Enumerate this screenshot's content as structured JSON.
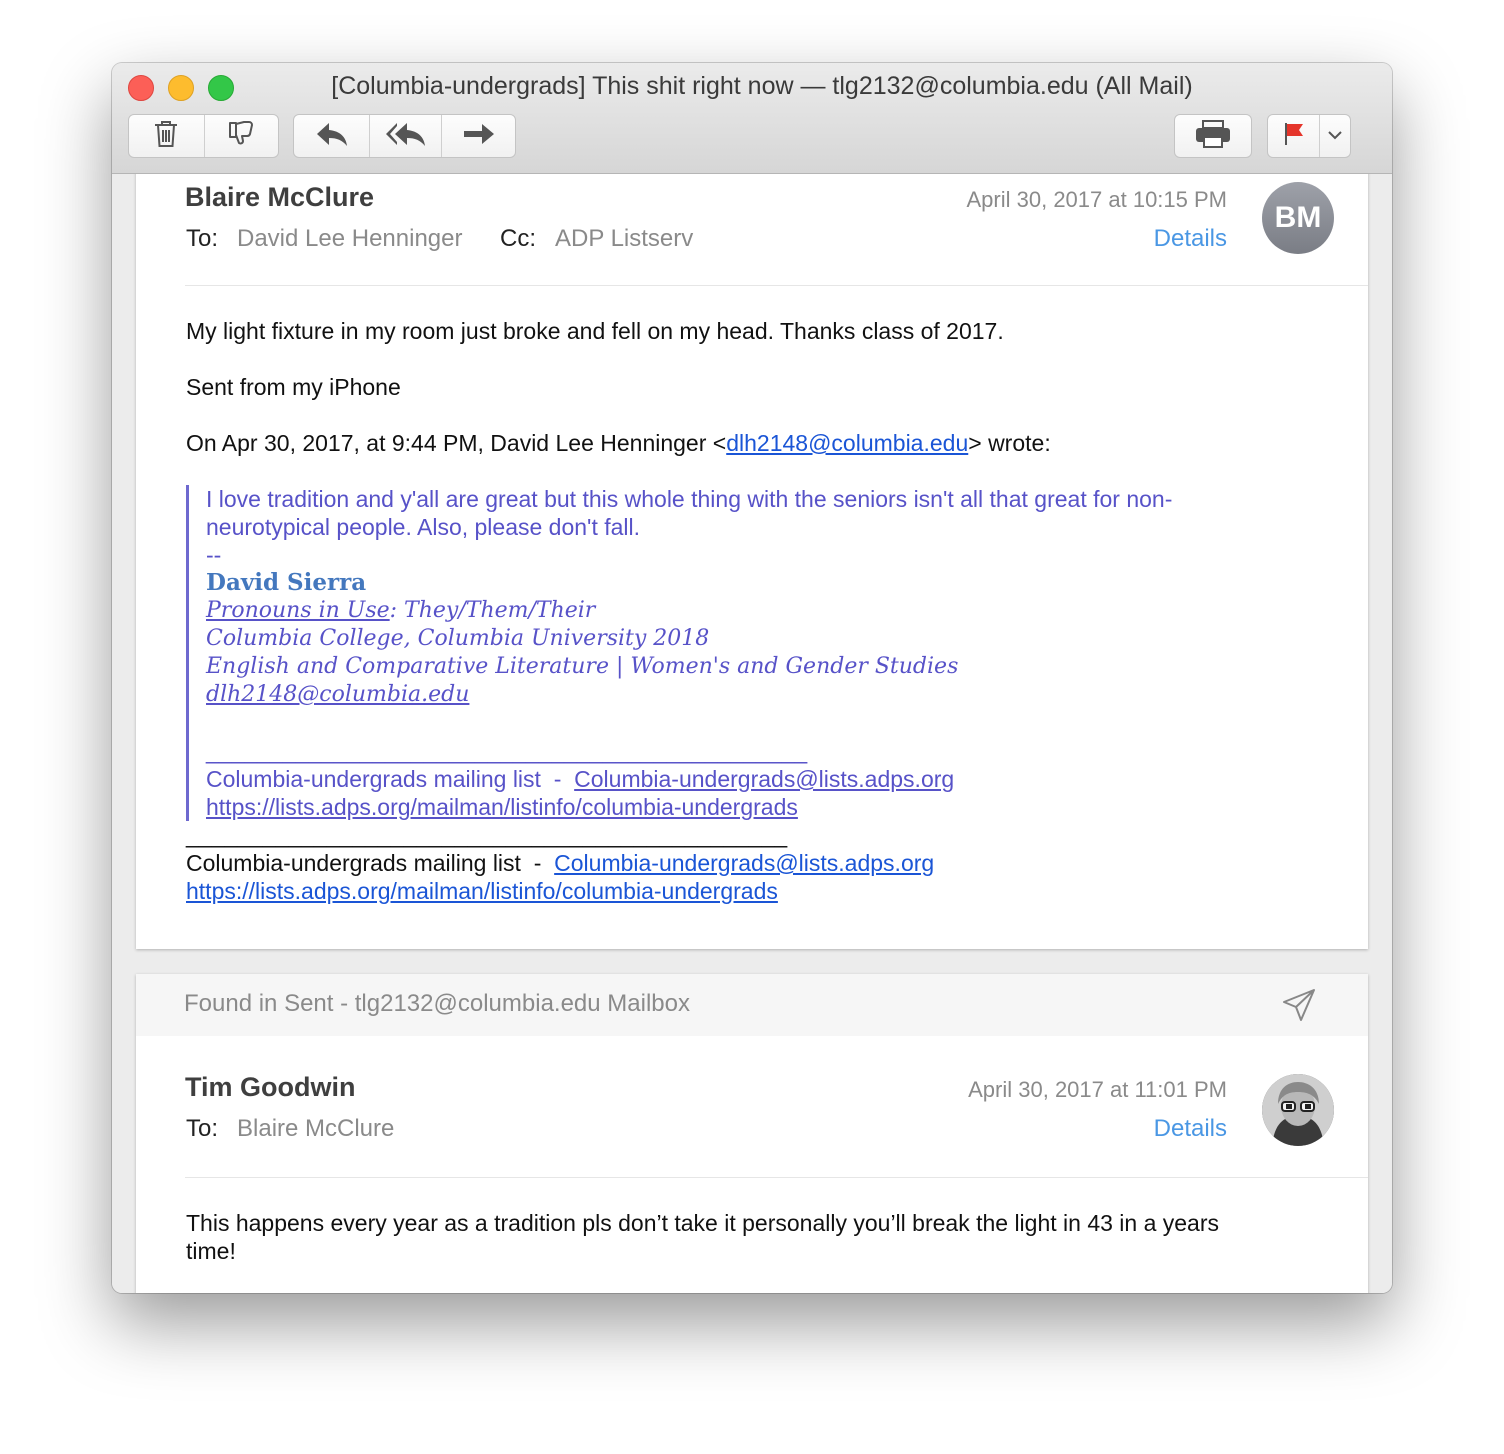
{
  "window": {
    "title": "[Columbia-undergrads] This shit right now — tlg2132@columbia.edu (All Mail)"
  },
  "toolbar": {
    "icons": [
      "trash-icon",
      "thumbs-down-icon",
      "reply-icon",
      "reply-all-icon",
      "forward-icon",
      "printer-icon",
      "flag-icon",
      "chevron-down-icon"
    ],
    "flag_color": "#e5352b"
  },
  "message1": {
    "sender": "Blaire McClure",
    "to_label": "To:",
    "to": "David Lee Henninger",
    "cc_label": "Cc:",
    "cc": "ADP Listserv",
    "date": "April 30, 2017 at 10:15 PM",
    "details": "Details",
    "avatar_initials": "BM",
    "body_line1": "My light fixture in my room just broke and fell on my head. Thanks class of 2017.",
    "body_line2": "Sent from my iPhone",
    "wrote_prefix": "On Apr 30, 2017, at 9:44 PM, David Lee Henninger <",
    "wrote_email": "dlh2148@columbia.edu",
    "wrote_suffix": "> wrote:",
    "quote": {
      "text": "I love tradition and y'all are great but this whole thing with the seniors isn't all that great for non-neurotypical people. Also, please don't fall.",
      "dashes": "--",
      "sig_name": "David Sierra",
      "sig_pronouns_link": "Pronouns in Use",
      "sig_pronouns_rest": ": They/Them/Their",
      "sig_college": "Columbia College, Columbia University 2018",
      "sig_major": "English and Comparative Literature | Women's and Gender Studies",
      "sig_email": "dlh2148@columbia.edu",
      "rule": "_______________________________________________",
      "list_label": "Columbia-undergrads mailing list  -  ",
      "list_email": "Columbia-undergrads@lists.adps.org",
      "list_url": "https://lists.adps.org/mailman/listinfo/columbia-undergrads"
    },
    "footer_rule": "_______________________________________________",
    "footer_label": "Columbia-undergrads mailing list  -  ",
    "footer_email": "Columbia-undergrads@lists.adps.org",
    "footer_url": "https://lists.adps.org/mailman/listinfo/columbia-undergrads"
  },
  "message2": {
    "found_in": "Found in Sent - tlg2132@columbia.edu Mailbox",
    "sender": "Tim Goodwin",
    "to_label": "To:",
    "to": "Blaire McClure",
    "date": "April 30, 2017 at 11:01 PM",
    "details": "Details",
    "body": "This happens every year as a tradition pls don’t take it personally you’ll break the light in 43 in a years time!"
  }
}
